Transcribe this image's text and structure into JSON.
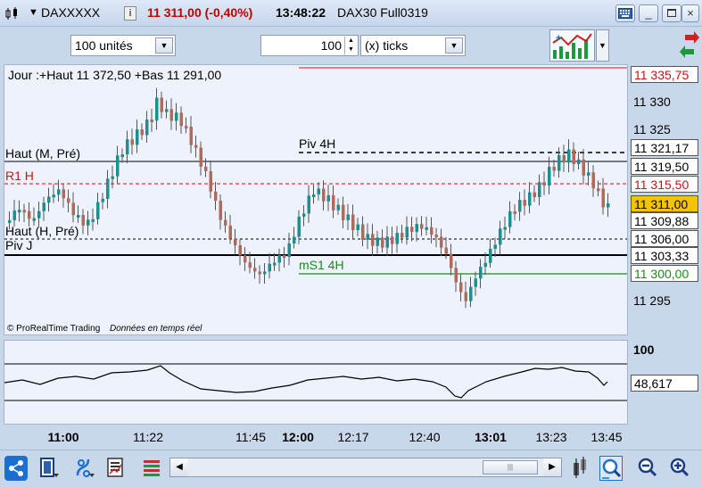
{
  "titlebar": {
    "symbol": "DAXXXXX",
    "info_label": "i",
    "price_change": "11 311,00 (-0,40%)",
    "time": "13:48:22",
    "instrument": "DAX30 Full0319",
    "keyboard_icon": "keyboard-icon",
    "minimize_label": "_",
    "close_label": "×"
  },
  "toolbar": {
    "quantity": "100 unités",
    "interval_value": "100",
    "interval_unit": "(x) ticks"
  },
  "chart": {
    "info_text": "Jour :+Haut 11 372,50 +Bas 11 291,00",
    "copyright": "© ProRealTime Trading",
    "realtime_note": "Données en temps réel",
    "level_labels": [
      {
        "text": "Haut (M, Pré)",
        "color": "#000000"
      },
      {
        "text": "R1 H",
        "color": "#d01010"
      },
      {
        "text": "Haut (H, Pré)",
        "color": "#000000"
      },
      {
        "text": "Piv J",
        "color": "#000000"
      },
      {
        "text": "Piv 4H",
        "color": "#000000"
      },
      {
        "text": "mS1 4H",
        "color": "#1a8a1a"
      }
    ],
    "price_labels": [
      {
        "text": "11 335,75",
        "color": "#d01010",
        "boxed": true
      },
      {
        "text": "11 330",
        "color": "#000000",
        "boxed": false
      },
      {
        "text": "11 325",
        "color": "#000000",
        "boxed": false
      },
      {
        "text": "11 321,17",
        "color": "#000000",
        "boxed": true
      },
      {
        "text": "11 319,50",
        "color": "#000000",
        "boxed": true
      },
      {
        "text": "11 315,50",
        "color": "#d01010",
        "boxed": true
      },
      {
        "text": "11 311,00",
        "color": "#000000",
        "boxed": true,
        "bg": "#f5c400"
      },
      {
        "text": "11 309,88",
        "color": "#000000",
        "boxed": true
      },
      {
        "text": "11 306,00",
        "color": "#000000",
        "boxed": true
      },
      {
        "text": "11 303,33",
        "color": "#000000",
        "boxed": true
      },
      {
        "text": "11 300,00",
        "color": "#1a8a1a",
        "boxed": true
      },
      {
        "text": "11 295",
        "color": "#000000",
        "boxed": false
      }
    ],
    "indicator_top_label": "100",
    "indicator_value": "48,617",
    "x_labels": [
      {
        "text": "11:00",
        "bold": true
      },
      {
        "text": "11:22",
        "bold": false
      },
      {
        "text": "11:45",
        "bold": false
      },
      {
        "text": "12:00",
        "bold": true
      },
      {
        "text": "12:17",
        "bold": false
      },
      {
        "text": "12:40",
        "bold": false
      },
      {
        "text": "13:01",
        "bold": true
      },
      {
        "text": "13:23",
        "bold": false
      },
      {
        "text": "13:45",
        "bold": false
      }
    ]
  },
  "colors": {
    "up_candle": "#1e8f8f",
    "down_candle": "#b06a5a",
    "resistance": "#d01010",
    "support": "#1a8a1a",
    "accent": "#1a6fd0"
  },
  "bottom": {
    "icons": [
      "share-icon",
      "layout-icon",
      "indicator-icon",
      "report-icon",
      "bars-icon",
      "tools-icon",
      "zoom-fit-icon",
      "zoom-out-icon",
      "zoom-in-icon"
    ]
  }
}
